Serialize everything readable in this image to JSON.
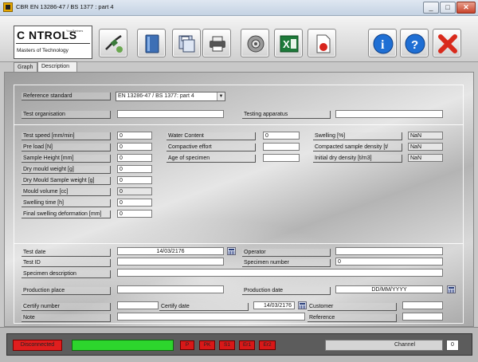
{
  "window": {
    "title": "CBR EN 13286-47 / BS 1377 : part 4",
    "minimize": "_",
    "maximize": "□",
    "close": "✕"
  },
  "logo": {
    "word": "C NTROLS",
    "tagline": "Your Partners",
    "subtitle": "Masters of Technology"
  },
  "toolbar": {
    "buttons": [
      "connect-icon",
      "binder-icon",
      "save-disk-icon",
      "printer-icon",
      "settings-gear-icon",
      "excel-export-icon",
      "pdf-export-icon",
      "info-icon",
      "help-icon",
      "exit-icon"
    ]
  },
  "tabs": [
    "Graph",
    "Description"
  ],
  "form": {
    "reference_standard_label": "Reference standard",
    "reference_standard_value": "EN 13286-47 / BS 1377: part 4",
    "test_organisation_label": "Test organisation",
    "test_organisation_value": "",
    "testing_apparatus_label": "Testing apparatus",
    "testing_apparatus_value": "",
    "test_speed_label": "Test speed [mm/min]",
    "test_speed_value": "0",
    "pre_load_label": "Pre load [N]",
    "pre_load_value": "0",
    "sample_height_label": "Sample Height [mm]",
    "sample_height_value": "0",
    "dry_mould_weight_label": "Dry mould weight [g]",
    "dry_mould_weight_value": "0",
    "dry_mould_sample_weight_label": "Dry Mould Sample weight [g]",
    "dry_mould_sample_weight_value": "0",
    "mould_volume_label": "Mould volume [cc]",
    "mould_volume_value": "0",
    "swelling_time_label": "Swelling time [h]",
    "swelling_time_value": "0",
    "final_swelling_label": "Final swelling deformation [mm]",
    "final_swelling_value": "0",
    "water_content_label": "Water Content",
    "water_content_value": "0",
    "compactive_effort_label": "Compactive effort",
    "compactive_effort_value": "",
    "age_of_specimen_label": "Age of specimen",
    "age_of_specimen_value": "",
    "swelling_pct_label": "Swelling [%]",
    "swelling_pct_value": "NaN",
    "compacted_density_label": "Compacted sample density [t/",
    "compacted_density_value": "NaN",
    "initial_dry_density_label": "Initial dry density [t/m3]",
    "initial_dry_density_value": "NaN",
    "test_date_label": "Test date",
    "test_date_value": "14/03/2176",
    "operator_label": "Operator",
    "operator_value": "",
    "test_id_label": "Test ID",
    "test_id_value": "",
    "specimen_number_label": "Specimen number",
    "specimen_number_value": "0",
    "specimen_description_label": "Specimen description",
    "specimen_description_value": "",
    "production_place_label": "Production place",
    "production_place_value": "",
    "production_date_label": "Production date",
    "production_date_value": "DD/MM/YYYY",
    "certify_number_label": "Certify number",
    "certify_number_value": "",
    "certify_date_label": "Certify date",
    "certify_date_value": "14/03/2176",
    "customer_label": "Customer",
    "customer_value": "",
    "note_label": "Note",
    "note_value": "",
    "reference_label": "Reference",
    "reference_value": ""
  },
  "status": {
    "connection": "Disconnected",
    "indicators": [
      "P",
      "PK",
      "S1",
      "Er1",
      "Er2"
    ],
    "channel_label": "Channel",
    "channel_value": "0",
    "colors": {
      "disconnected": "#e01e1e",
      "progress": "#2dd52d",
      "indicator": "#d81818"
    }
  }
}
